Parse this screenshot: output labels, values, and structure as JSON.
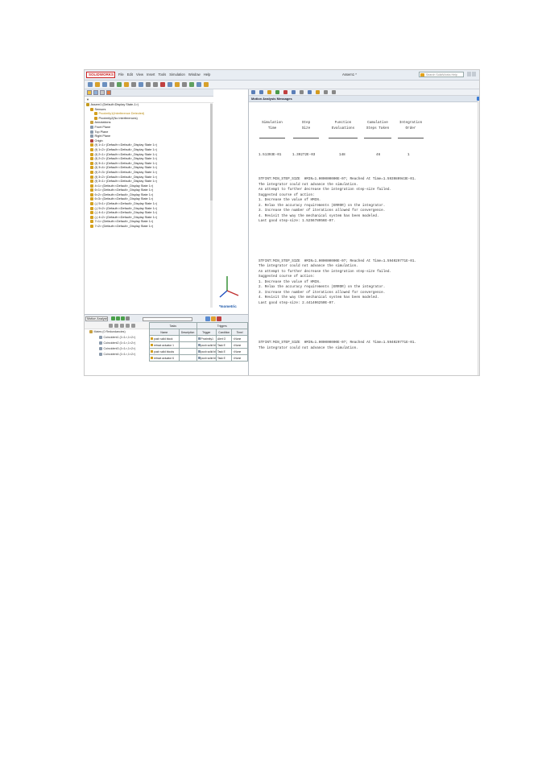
{
  "app": {
    "logo": "SOLIDWORKS",
    "doc_title": "Assem1 *",
    "search_placeholder": "Search SolidWorks Help",
    "menus": [
      "File",
      "Edit",
      "View",
      "Insert",
      "Tools",
      "Simulation",
      "Window",
      "Help"
    ]
  },
  "tree": {
    "filter": "▼",
    "items": [
      {
        "label": "Assem1 (Default<Display State-1>)",
        "indent": 0,
        "icon": "assembly-icon",
        "color": "#c59a1b"
      },
      {
        "label": "Sensors",
        "indent": 1,
        "icon": "sensor-icon",
        "color": "#d19a1c"
      },
      {
        "label": "Proximity1(Interference Detected)",
        "indent": 2,
        "icon": "warning-icon",
        "color": "#d4a01e",
        "text_color": "#b98a10"
      },
      {
        "label": "Proximity2(No Interferences)",
        "indent": 2,
        "icon": "sensor-item-icon",
        "color": "#d19a1c"
      },
      {
        "label": "Annotations",
        "indent": 1,
        "icon": "annotation-icon",
        "color": "#c8a040"
      },
      {
        "label": "Front Plane",
        "indent": 1,
        "icon": "plane-icon",
        "color": "#8a9aac"
      },
      {
        "label": "Top Plane",
        "indent": 1,
        "icon": "plane-icon",
        "color": "#8a9aac"
      },
      {
        "label": "Right Plane",
        "indent": 1,
        "icon": "plane-icon",
        "color": "#8a9aac"
      },
      {
        "label": "Origin",
        "indent": 1,
        "icon": "origin-icon",
        "color": "#b04040"
      },
      {
        "label": "(f) 1<1> (Default<<Default>_Display State 1>)",
        "indent": 1,
        "icon": "part-icon",
        "color": "#d4a01e"
      },
      {
        "label": "(f) 1<2> (Default<<Default>_Display State 1>)",
        "indent": 1,
        "icon": "part-icon",
        "color": "#d4a01e"
      },
      {
        "label": "(f) 2<1> (Default<<Default>_Display State 1>)",
        "indent": 1,
        "icon": "part-icon",
        "color": "#d4a01e"
      },
      {
        "label": "(f) 2<2> (Default<<Default>_Display State 1>)",
        "indent": 1,
        "icon": "part-icon",
        "color": "#d4a01e"
      },
      {
        "label": "(f) 3<1> (Default<<Default>_Display State 1>)",
        "indent": 1,
        "icon": "part-icon",
        "color": "#d4a01e"
      },
      {
        "label": "(f) 3<4> (Default<<Default>_Display State 1>)",
        "indent": 1,
        "icon": "part-icon",
        "color": "#d4a01e"
      },
      {
        "label": "(f) 2<3> (Default<<Default>_Display State 1>)",
        "indent": 1,
        "icon": "part-icon",
        "color": "#d4a01e"
      },
      {
        "label": "(f) 3<2> (Default<<Default>_Display State 1>)",
        "indent": 1,
        "icon": "part-icon",
        "color": "#d4a01e"
      },
      {
        "label": "(f) 3<1> (Default<<Default>_Display State 1>)",
        "indent": 1,
        "icon": "part-icon",
        "color": "#d4a01e"
      },
      {
        "label": "4<1> (Default<<Default>_Display State 1>)",
        "indent": 1,
        "icon": "part-icon",
        "color": "#d4a01e"
      },
      {
        "label": "6<1> (Default<<Default>_Display State 1>)",
        "indent": 1,
        "icon": "part-icon",
        "color": "#d4a01e"
      },
      {
        "label": "6<2> (Default<<Default>_Display State 1>)",
        "indent": 1,
        "icon": "part-icon",
        "color": "#d4a01e"
      },
      {
        "label": "6<3> (Default<<Default>_Display State 1>)",
        "indent": 1,
        "icon": "part-icon",
        "color": "#d4a01e"
      },
      {
        "label": "(-) 5<1> (Default<<Default>_Display State 1>)",
        "indent": 1,
        "icon": "part-icon",
        "color": "#d4a01e"
      },
      {
        "label": "(-) 5<2> (Default<<Default>_Display State 1>)",
        "indent": 1,
        "icon": "part-icon",
        "color": "#d4a01e"
      },
      {
        "label": "(-) 4<1> (Default<<Default>_Display State 1>)",
        "indent": 1,
        "icon": "part-icon",
        "color": "#d4a01e"
      },
      {
        "label": "(-) 4<2> (Default<<Default>_Display State 1>)",
        "indent": 1,
        "icon": "part-icon",
        "color": "#d4a01e"
      },
      {
        "label": "7<1> (Default<<Default>_Display State 1>)",
        "indent": 1,
        "icon": "part-icon",
        "color": "#d4a01e"
      },
      {
        "label": "7<2> (Default<<Default>_Display State 1>)",
        "indent": 1,
        "icon": "part-icon",
        "color": "#d4a01e"
      }
    ]
  },
  "viewport": {
    "view_label": "*Isometric"
  },
  "messages": {
    "header": "Motion Analysis Messages",
    "columns": [
      {
        "line1": "Simulation",
        "line2": "Time"
      },
      {
        "line1": "Step",
        "line2": "Size"
      },
      {
        "line1": "Function",
        "line2": "Evaluations"
      },
      {
        "line1": "Cumulative",
        "line2": "Steps Taken"
      },
      {
        "line1": "Integration",
        "line2": "Order"
      }
    ],
    "values": [
      "1.51393E-01",
      "1.39272E-03",
      "148",
      "46",
      "1"
    ],
    "blocks": [
      [
        "STFINT:MIN_STEP_SIZE  HMIN=1.000000000E-07; Reached At Time=1.593980943E-01.",
        "The integrator could not advance the simulation.",
        "An attempt to further decrease the integration step-size failed.",
        "Suggested course of action:",
        "1. Decrease the value of HMIN.",
        "2. Relax the accuracy requirements (ERROR) on the integrator.",
        "3. Increase the number of iterations allowed for convergence.",
        "4. Revisit the way the mechanical system has been modeled.",
        "Last good step-size: 1.525678956E-07."
      ],
      [
        "STFINT:MIN_STEP_SIZE  HMIN=1.000000000E-07; Reached At Time=1.594029771E-01.",
        "The integrator could not advance the simulation.",
        "An attempt to further decrease the integration step-size failed.",
        "Suggested course of action:",
        "1. Decrease the value of HMIN.",
        "2. Relax the accuracy requirements (ERROR) on the integrator.",
        "3. Increase the number of iterations allowed for convergence.",
        "4. Revisit the way the mechanical system has been modeled.",
        "Last good step-size: 2.441406250E-07."
      ],
      [
        "STFINT:MIN_STEP_SIZE  HMIN=1.000000000E-07; Reached At Time=1.594029771E-01.",
        "The integrator could not advance the simulation."
      ]
    ]
  },
  "motion": {
    "study_type": "Motion Analysis",
    "tree": [
      {
        "label": "Mates (0 Redundancies)",
        "indent": 0
      },
      {
        "label": "Coincident1 (1<1>,1<2>)",
        "indent": 1
      },
      {
        "label": "Coincident2 (1<1>,1<2>)",
        "indent": 1
      },
      {
        "label": "Coincident3 (1<1>,1<2>)",
        "indent": 1
      },
      {
        "label": "Coincident4 (1<1>,1<2>)",
        "indent": 1
      }
    ],
    "group_headers": {
      "tasks": "Tasks",
      "triggers": "Triggers"
    },
    "columns": [
      "Name",
      "Description",
      "Trigger",
      "Condition",
      "Time/"
    ],
    "rows": [
      [
        "push solid block",
        "",
        "Proximity1",
        "Alert O",
        "<None"
      ],
      [
        "retract actuator 1",
        "",
        "push solid bl",
        "Task E",
        "<None"
      ],
      [
        "push solid blocks",
        "",
        "push solid bl",
        "Task E",
        "<None"
      ],
      [
        "retract actuator 6",
        "",
        "push solid bl",
        "Task E",
        "<None"
      ]
    ]
  }
}
